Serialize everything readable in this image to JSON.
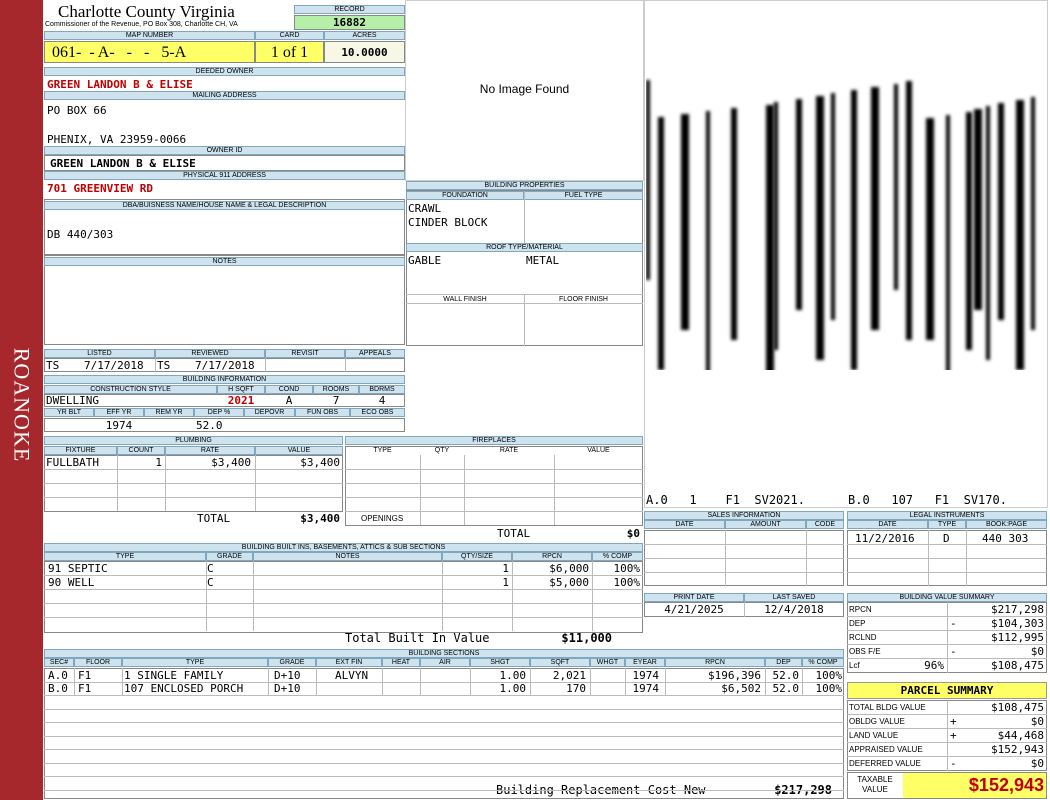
{
  "sidebar_label": "ROANOKE",
  "header": {
    "county": "Charlotte County Virginia",
    "commissioner": "Commissioner of the Revenue, PO Box 308, Charlotte CH, VA",
    "record_label": "RECORD",
    "record": "16882",
    "map_label": "MAP NUMBER",
    "map_number": "061-  - A-   -   -   5-A",
    "card_label": "CARD",
    "card": "1 of 1",
    "acres_label": "ACRES",
    "acres": "10.0000"
  },
  "owner": {
    "deeded_label": "DEEDED OWNER",
    "deeded": "GREEN LANDON B & ELISE",
    "mailing_label": "MAILING ADDRESS",
    "mailing_line1": "PO BOX 66",
    "mailing_line2": "PHENIX, VA 23959-0066",
    "owner_id_label": "OWNER ID",
    "owner_id": "GREEN LANDON B & ELISE",
    "physical_label": "PHYSICAL 911 ADDRESS",
    "physical": "701 GREENVIEW RD",
    "dba_label": "DBA/BUISNESS NAME/HOUSE NAME & LEGAL DESCRIPTION",
    "dba": "DB 440/303",
    "notes_label": "NOTES"
  },
  "image_placeholder": "No Image Found",
  "building_properties": {
    "title": "BUILDING PROPERTIES",
    "foundation_label": "FOUNDATION",
    "foundation_1": "CRAWL",
    "foundation_2": "CINDER BLOCK",
    "fuel_label": "FUEL TYPE",
    "roof_label": "ROOF TYPE/MATERIAL",
    "roof_type": "GABLE",
    "roof_material": "METAL",
    "wall_label": "WALL FINISH",
    "floor_label": "FLOOR FINISH"
  },
  "review": {
    "listed_label": "LISTED",
    "listed_by": "TS",
    "listed_date": "7/17/2018",
    "reviewed_label": "REVIEWED",
    "reviewed_by": "TS",
    "reviewed_date": "7/17/2018",
    "revisit_label": "REVISIT",
    "appeals_label": "APPEALS"
  },
  "building_info": {
    "title": "BUILDING INFORMATION",
    "style_label": "CONSTRUCTION STYLE",
    "style": "DWELLING",
    "hsqft_label": "H SQFT",
    "hsqft": "2021",
    "cond_label": "COND",
    "cond": "A",
    "rooms_label": "ROOMS",
    "rooms": "7",
    "bdrms_label": "BDRMS",
    "bdrms": "4",
    "yrblt_label": "YR BLT",
    "effyr_label": "EFF YR",
    "effyr": "1974",
    "remyr_label": "REM YR",
    "dep_label": "DEP %",
    "dep": "52.0",
    "depovr_label": "DEPOVR",
    "funobs_label": "FUN OBS",
    "ecoobs_label": "ECO OBS"
  },
  "plumbing": {
    "title": "PLUMBING",
    "headers": [
      "FIXTURE",
      "COUNT",
      "RATE",
      "VALUE"
    ],
    "fixture": "FULLBATH",
    "count": "1",
    "rate": "$3,400",
    "value": "$3,400",
    "total_label": "TOTAL",
    "total": "$3,400"
  },
  "fireplaces": {
    "title": "FIREPLACES",
    "headers": [
      "TYPE",
      "QTY",
      "RATE",
      "VALUE"
    ],
    "openings_label": "OPENINGS",
    "total_label": "TOTAL",
    "total": "$0"
  },
  "barcode_caption": {
    "left": "A.0   1    F1  SV2021.",
    "right": "B.0   107   F1  SV170."
  },
  "builtins": {
    "title": "BUILDING BUILT INS, BASEMENTS, ATTICS & SUB SECTIONS",
    "headers": [
      "TYPE",
      "GRADE",
      "NOTES",
      "QTY/SIZE",
      "RPCN",
      "% COMP"
    ],
    "rows": [
      {
        "type": "91 SEPTIC",
        "grade": "C",
        "qty": "1",
        "rpcn": "$6,000",
        "comp": "100%"
      },
      {
        "type": "90 WELL",
        "grade": "C",
        "qty": "1",
        "rpcn": "$5,000",
        "comp": "100%"
      }
    ],
    "total_label": "Total Built In Value",
    "total": "$11,000"
  },
  "sales": {
    "title": "SALES INFORMATION",
    "headers": [
      "DATE",
      "AMOUNT",
      "CODE"
    ]
  },
  "legal": {
    "title": "LEGAL INSTRUMENTS",
    "headers": [
      "DATE",
      "TYPE",
      "BOOK:PAGE"
    ],
    "date": "11/2/2016",
    "type": "D",
    "bookpage": "440 303"
  },
  "dates": {
    "print_label": "PRINT DATE",
    "print_date": "4/21/2025",
    "saved_label": "LAST SAVED",
    "saved_date": "12/4/2018"
  },
  "value_summary": {
    "title": "BUILDING VALUE SUMMARY",
    "rows": [
      {
        "label": "RPCN",
        "sign": "",
        "pct": "",
        "value": "$217,298"
      },
      {
        "label": "DEP",
        "sign": "-",
        "pct": "",
        "value": "$104,303"
      },
      {
        "label": "RCLND",
        "sign": "",
        "pct": "",
        "value": "$112,995"
      },
      {
        "label": "OBS F/E",
        "sign": "-",
        "pct": "",
        "value": "$0"
      },
      {
        "label": "Lcf",
        "sign": "",
        "pct": "96%",
        "value": "$108,475"
      }
    ]
  },
  "parcel": {
    "title": "PARCEL SUMMARY",
    "rows": [
      {
        "label": "TOTAL BLDG VALUE",
        "sign": "",
        "value": "$108,475"
      },
      {
        "label": "OBLDG VALUE",
        "sign": "+",
        "value": "$0"
      },
      {
        "label": "LAND VALUE",
        "sign": "+",
        "value": "$44,468"
      },
      {
        "label": "APPRAISED VALUE",
        "sign": "",
        "value": "$152,943"
      },
      {
        "label": "DEFERRED VALUE",
        "sign": "-",
        "value": "$0"
      }
    ],
    "taxable_label_1": "TAXABLE",
    "taxable_label_2": "VALUE",
    "taxable": "$152,943"
  },
  "sections": {
    "title": "BUILDING SECTIONS",
    "headers": [
      "SEC#",
      "FLOOR",
      "TYPE",
      "GRADE",
      "EXT FIN",
      "HEAT",
      "AIR",
      "SHGT",
      "SQFT",
      "WHGT",
      "EYEAR",
      "RPCN",
      "DEP",
      "% COMP"
    ],
    "rows": [
      {
        "sec": "A.0",
        "floor": "F1",
        "type": "1 SINGLE FAMILY",
        "grade": "D+10",
        "ext": "ALVYN",
        "shgt": "1.00",
        "sqft": "2,021",
        "eyear": "1974",
        "rpcn": "$196,396",
        "dep": "52.0",
        "comp": "100%"
      },
      {
        "sec": "B.0",
        "floor": "F1",
        "type": "107 ENCLOSED PORCH",
        "grade": "D+10",
        "ext": "",
        "shgt": "1.00",
        "sqft": "170",
        "eyear": "1974",
        "rpcn": "$6,502",
        "dep": "52.0",
        "comp": "100%"
      }
    ],
    "total_label": "Building Replacement Cost New",
    "total": "$217,298"
  }
}
